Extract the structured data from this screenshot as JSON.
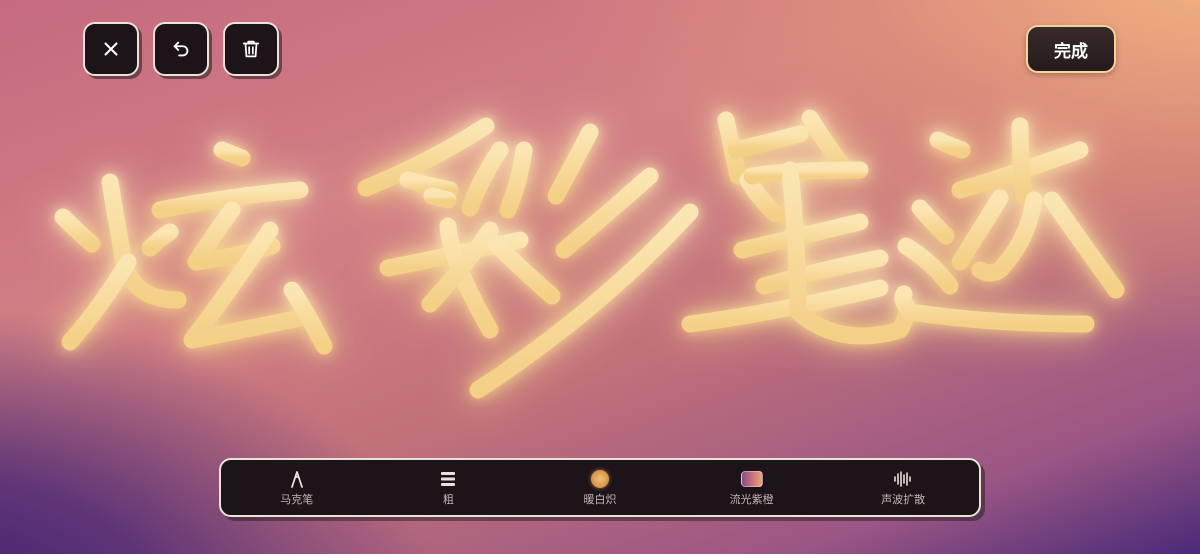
{
  "header": {
    "done_label": "完成"
  },
  "top_icons": [
    "close-icon",
    "undo-icon",
    "trash-icon"
  ],
  "toolbar": {
    "tools": [
      {
        "label": "马克笔",
        "icon": "marker-pen-icon"
      },
      {
        "label": "粗",
        "icon": "stroke-width-icon"
      },
      {
        "label": "暖白炽",
        "icon": "color-swatch-icon"
      },
      {
        "label": "流光紫橙",
        "icon": "gradient-swatch-icon"
      },
      {
        "label": "声波扩散",
        "icon": "sound-wave-icon"
      }
    ]
  },
  "colors": {
    "stroke": "#f6d89a",
    "glow": "#f3a84e",
    "button_bg": "#1c1418",
    "button_border": "#e9e2d6",
    "done_border": "#f1d39c"
  }
}
